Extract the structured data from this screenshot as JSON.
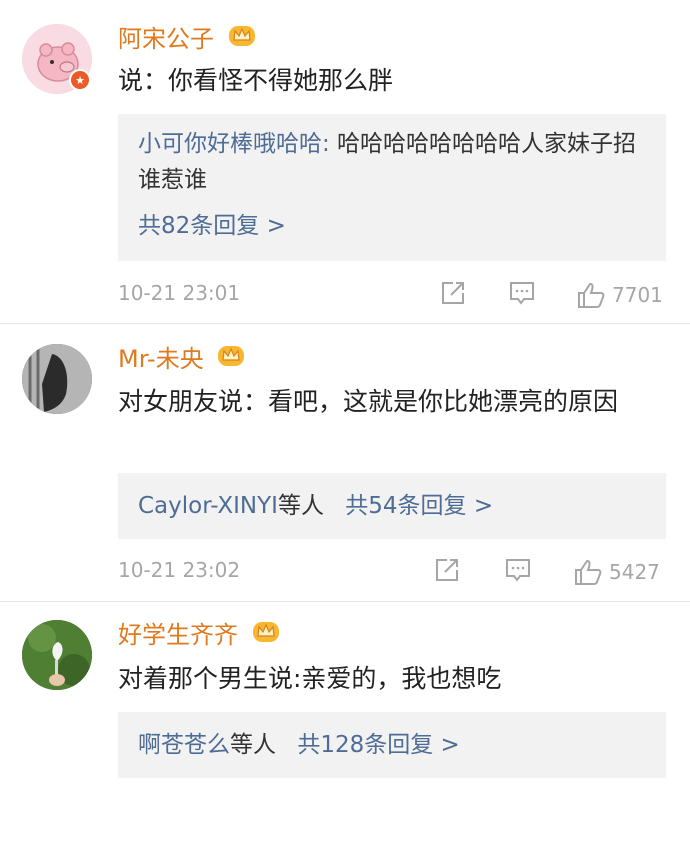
{
  "colors": {
    "name": "#e07a1f",
    "link": "#4f6c95",
    "meta": "#a6a6a6",
    "reply_bg": "#f2f2f2"
  },
  "comments": [
    {
      "name": "阿宋公子",
      "text": "说：你看怪不得她那么胖",
      "reply_user": "小可你好棒哦哈哈:",
      "reply_text": " 哈哈哈哈哈哈哈哈人家妹子招谁惹谁",
      "reply_more": "共82条回复 >",
      "time": "10-21 23:01",
      "likes": "7701"
    },
    {
      "name": "Mr-未央",
      "text": "对女朋友说：看吧，这就是你比她漂亮的原因",
      "reply_user": "Caylor-XINYI",
      "reply_mid": "等人",
      "reply_more": "共54条回复 >",
      "time": "10-21 23:02",
      "likes": "5427"
    },
    {
      "name": "好学生齐齐",
      "text": "对着那个男生说:亲爱的，我也想吃",
      "reply_user": "啊苍苍么",
      "reply_mid": "等人",
      "reply_more": "共128条回复 >"
    }
  ],
  "icons": [
    "crown-icon",
    "share-icon",
    "comment-icon",
    "like-icon",
    "star-badge-icon"
  ]
}
